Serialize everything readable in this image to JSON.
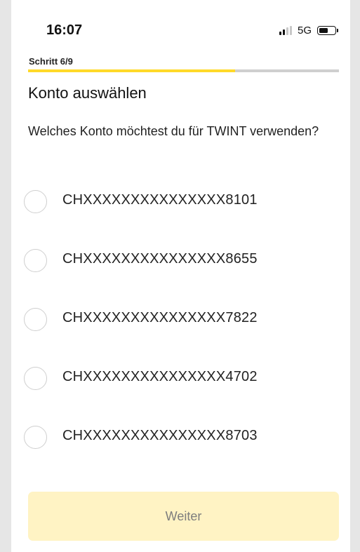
{
  "status_bar": {
    "time": "16:07",
    "network": "5G",
    "signal_bars_active": 2,
    "signal_bars_total": 4,
    "battery_level": 0.5
  },
  "step": {
    "label": "Schritt 6/9",
    "progress": 0.667
  },
  "colors": {
    "accent": "#ffd929",
    "track": "#cfcfcf",
    "button_disabled_bg": "#fff3c4"
  },
  "page": {
    "title": "Konto auswählen",
    "question": "Welches Konto möchtest du für TWINT verwenden?"
  },
  "accounts": [
    {
      "label": "CHXXXXXXXXXXXXXXX8101",
      "selected": false
    },
    {
      "label": "CHXXXXXXXXXXXXXXX8655",
      "selected": false
    },
    {
      "label": "CHXXXXXXXXXXXXXXX7822",
      "selected": false
    },
    {
      "label": "CHXXXXXXXXXXXXXXX4702",
      "selected": false
    },
    {
      "label": "CHXXXXXXXXXXXXXXX8703",
      "selected": false
    }
  ],
  "continue_button": {
    "label": "Weiter",
    "enabled": false
  }
}
